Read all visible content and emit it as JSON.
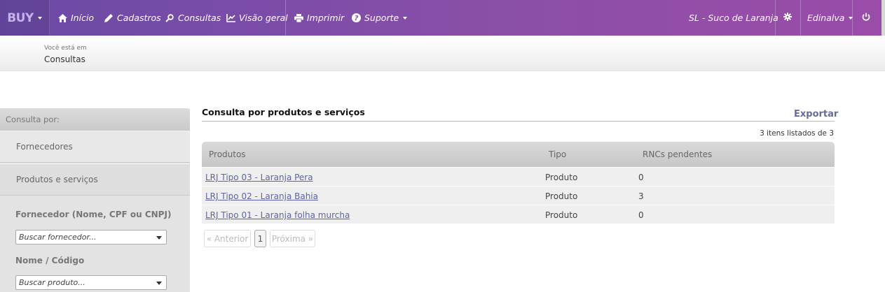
{
  "navbar": {
    "brand": "BUY",
    "items": [
      {
        "label": "Início",
        "icon": "home-icon"
      },
      {
        "label": "Cadastros",
        "icon": "pencil-icon"
      },
      {
        "label": "Consultas",
        "icon": "search-icon"
      },
      {
        "label": "Visão geral",
        "icon": "chart-icon"
      },
      {
        "label": "Imprimir",
        "icon": "printer-icon"
      },
      {
        "label": "Suporte",
        "icon": "help-icon"
      }
    ],
    "company": "SL - Suco de Laranja",
    "settings_icon": "gear-icon",
    "user": "Edinalva",
    "power_icon": "power-icon",
    "colors": {
      "gradient_start": "#6a4aa6",
      "gradient_end": "#9a4ca9"
    }
  },
  "breadcrumb": {
    "prefix": "Você está em",
    "current": "Consultas"
  },
  "sidebar": {
    "heading": "Consulta por:",
    "items": [
      {
        "label": "Fornecedores"
      },
      {
        "label": "Produtos e serviços"
      }
    ],
    "filters": [
      {
        "label": "Fornecedor (Nome, CPF ou CNPJ)",
        "placeholder": "Buscar fornecedor..."
      },
      {
        "label": "Nome / Código",
        "placeholder": "Buscar produto..."
      }
    ]
  },
  "main": {
    "title": "Consulta por produtos e serviços",
    "export": "Exportar",
    "count": "3 itens listados de 3",
    "columns": [
      "Produtos",
      "Tipo",
      "RNCs pendentes"
    ],
    "rows": [
      {
        "produto": "LRJ Tipo 03 - Laranja Pera",
        "tipo": "Produto",
        "rncs": "0"
      },
      {
        "produto": "LRJ Tipo 02 - Laranja Bahia",
        "tipo": "Produto",
        "rncs": "3"
      },
      {
        "produto": "LRJ Tipo 01 - Laranja folha murcha",
        "tipo": "Produto",
        "rncs": "0"
      }
    ],
    "pagination": {
      "prev": "« Anterior",
      "page": "1",
      "next": "Próxima »"
    }
  }
}
